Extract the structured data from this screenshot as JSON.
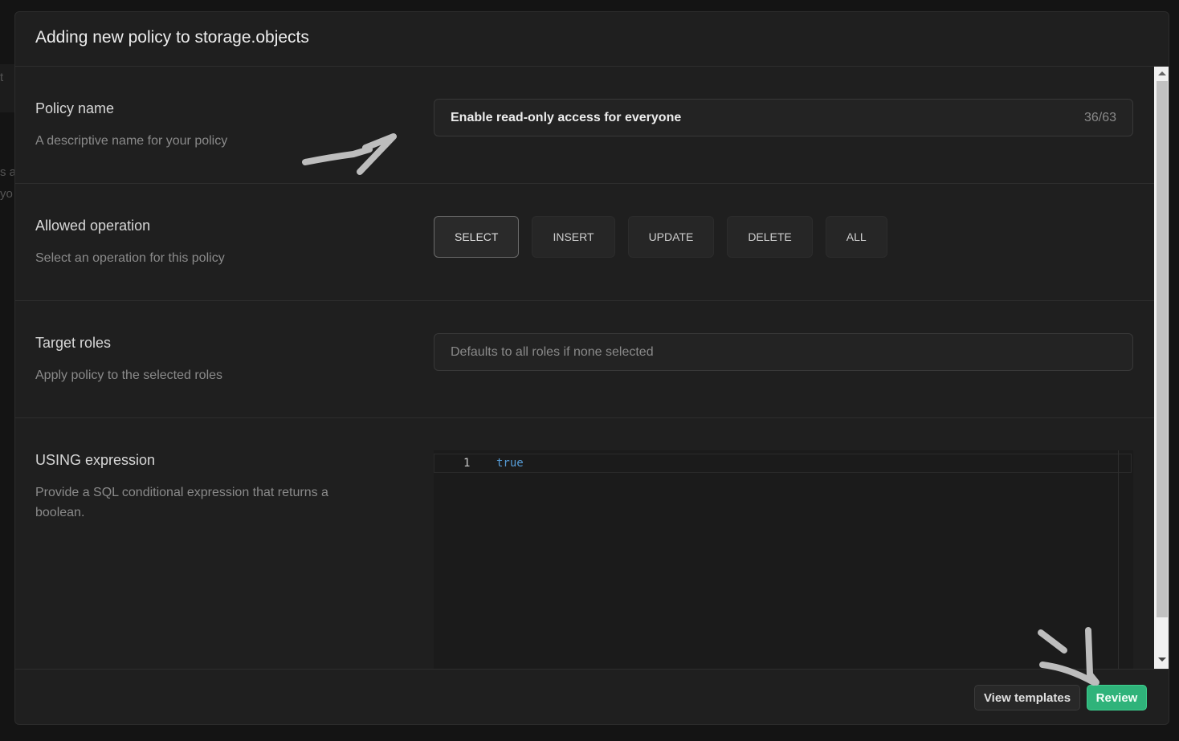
{
  "modal": {
    "title": "Adding new policy to storage.objects"
  },
  "policy_name": {
    "label": "Policy name",
    "description": "A descriptive name for your policy",
    "value": "Enable read-only access for everyone",
    "counter": "36/63"
  },
  "allowed_operation": {
    "label": "Allowed operation",
    "description": "Select an operation for this policy",
    "options": [
      "SELECT",
      "INSERT",
      "UPDATE",
      "DELETE",
      "ALL"
    ],
    "selected": "SELECT"
  },
  "target_roles": {
    "label": "Target roles",
    "description": "Apply policy to the selected roles",
    "placeholder": "Defaults to all roles if none selected"
  },
  "using_expression": {
    "label": "USING expression",
    "description": "Provide a SQL conditional expression that returns a boolean.",
    "line_number": "1",
    "code": "true"
  },
  "footer": {
    "view_templates": "View templates",
    "review": "Review"
  },
  "background": {
    "fragments": [
      "t",
      "s a",
      "yo"
    ]
  },
  "colors": {
    "accent": "#3ecf8e",
    "background": "#1f1f1f"
  }
}
